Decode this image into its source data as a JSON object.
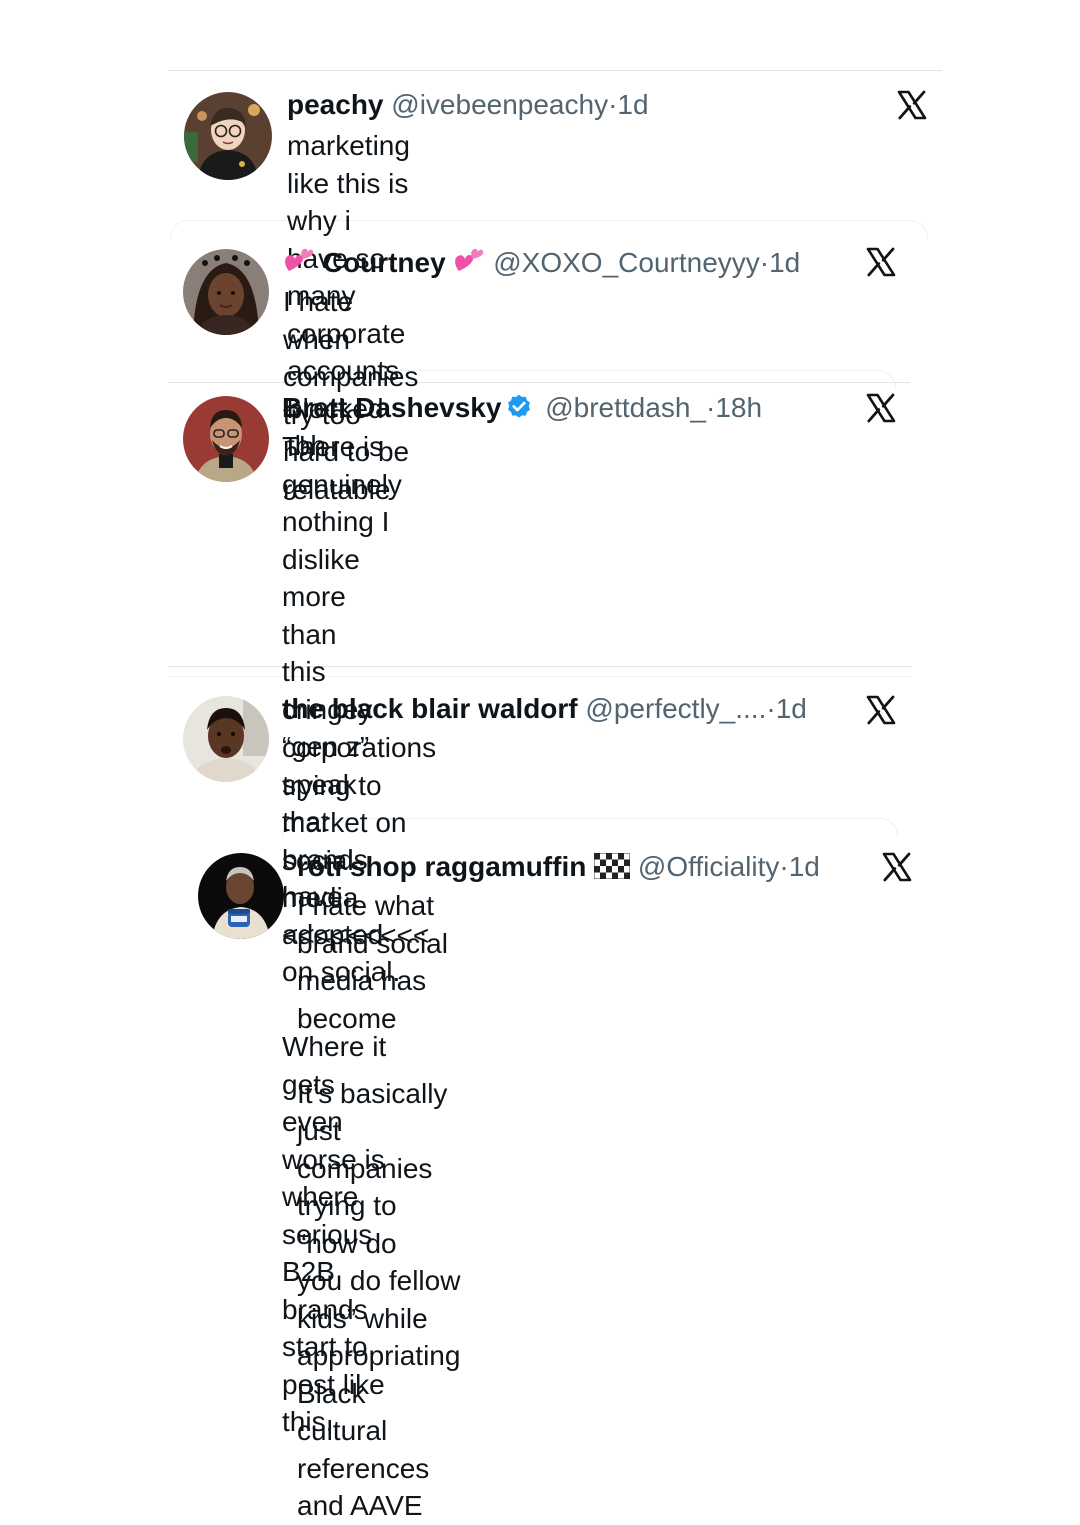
{
  "tweets": [
    {
      "name": "peachy",
      "handle": "@ivebeenpeachy",
      "separator": "·",
      "time": "1d",
      "text": "marketing like this is why i have so many\ncorporate accounts blocked tbh"
    },
    {
      "name": "Courtney",
      "name_emoji": "heart-emoji",
      "handle": "@XOXO_Courtneyyy",
      "separator": "·",
      "time": "1d",
      "text": "I hate when companies try too hard to be\nrelatable"
    },
    {
      "name": "Brett Dashevsky",
      "verified": true,
      "handle": "@brettdash_",
      "separator": "·",
      "time": "18h",
      "text": "There is genuinely nothing I dislike more than\nthis cringey “gen z” speak that brands have\nadopted on social.\n\nWhere it gets even worse is where serious B2B\nbrands start to post like this."
    },
    {
      "name": "the black blair waldorf",
      "handle": "@perfectly_....",
      "separator": "·",
      "time": "1d",
      "text": "corporations trying to market on social media\n<<<<<<<<<"
    },
    {
      "name": "roti shop raggamuffin",
      "name_emoji": "checkered-flag-emoji",
      "handle": "@Officiality",
      "separator": "·",
      "time": "1d",
      "text": "I hate what brand social media has become\n\nIt’s basically just companies trying to “how do\nyou do fellow kids” while appropriating Black\ncultural references and AAVE"
    }
  ],
  "icons": {
    "platform": "x-logo-icon",
    "verified": "verified-badge-icon"
  },
  "colors": {
    "text": "#0f1419",
    "secondary": "#536471",
    "verified": "#1d9bf0",
    "heart": "#f050a8",
    "divider": "#e3e6e8"
  }
}
